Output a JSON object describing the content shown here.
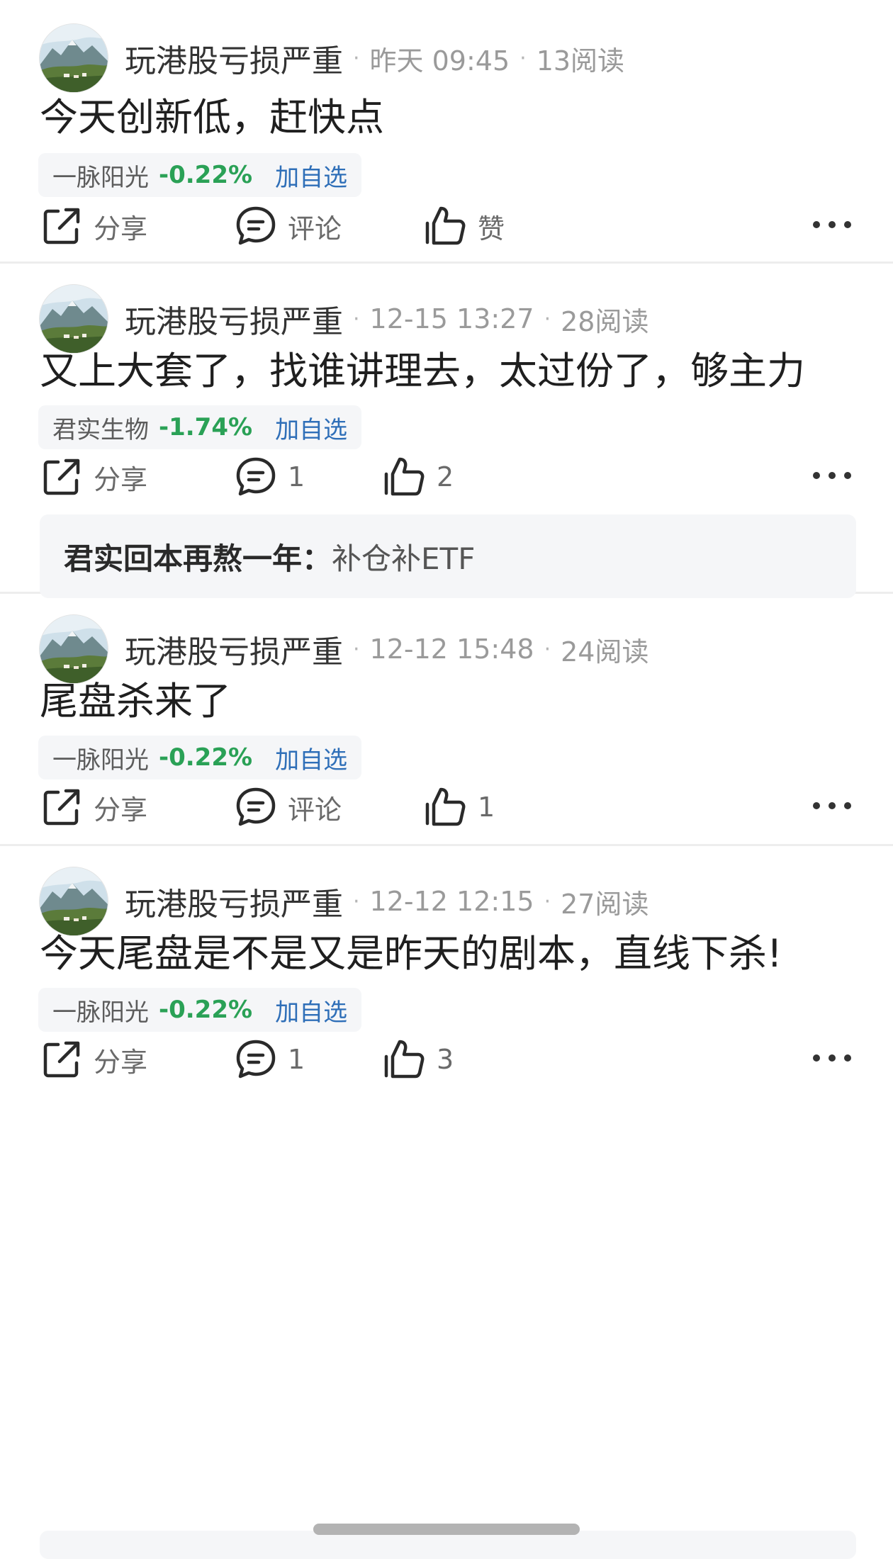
{
  "posts": [
    {
      "author": "玩港股亏损严重",
      "time": "昨天 09:45",
      "reads": "13阅读",
      "content": "今天创新低，赶快点",
      "stock": {
        "name": "一脉阳光",
        "change": "-0.22%",
        "add_label": "加自选"
      },
      "actions": {
        "share": "分享",
        "comment": "评论",
        "like": "赞"
      }
    },
    {
      "author": "玩港股亏损严重",
      "time": "12-15 13:27",
      "reads": "28阅读",
      "content": "又上大套了，找谁讲理去，太过份了，够主力",
      "stock": {
        "name": "君实生物",
        "change": "-1.74%",
        "add_label": "加自选"
      },
      "actions": {
        "share": "分享",
        "comment": "1",
        "like": "2"
      },
      "reply": {
        "user": "君实回本再熬一年：",
        "text": "补仓补ETF"
      }
    },
    {
      "author": "玩港股亏损严重",
      "time": "12-12 15:48",
      "reads": "24阅读",
      "content": "尾盘杀来了",
      "stock": {
        "name": "一脉阳光",
        "change": "-0.22%",
        "add_label": "加自选"
      },
      "actions": {
        "share": "分享",
        "comment": "评论",
        "like": "1"
      }
    },
    {
      "author": "玩港股亏损严重",
      "time": "12-12 12:15",
      "reads": "27阅读",
      "content": "今天尾盘是不是又是昨天的剧本，直线下杀!",
      "stock": {
        "name": "一脉阳光",
        "change": "-0.22%",
        "add_label": "加自选"
      },
      "actions": {
        "share": "分享",
        "comment": "1",
        "like": "3"
      }
    }
  ],
  "separator": "·",
  "colors": {
    "negative_change": "#2aa156",
    "add_link": "#2f6fb8",
    "tag_bg": "#f5f6f8"
  },
  "icons": {
    "share": "share-icon",
    "comment": "comment-icon",
    "like": "thumbs-up-icon",
    "more": "more-icon",
    "avatar": "avatar-landscape"
  }
}
